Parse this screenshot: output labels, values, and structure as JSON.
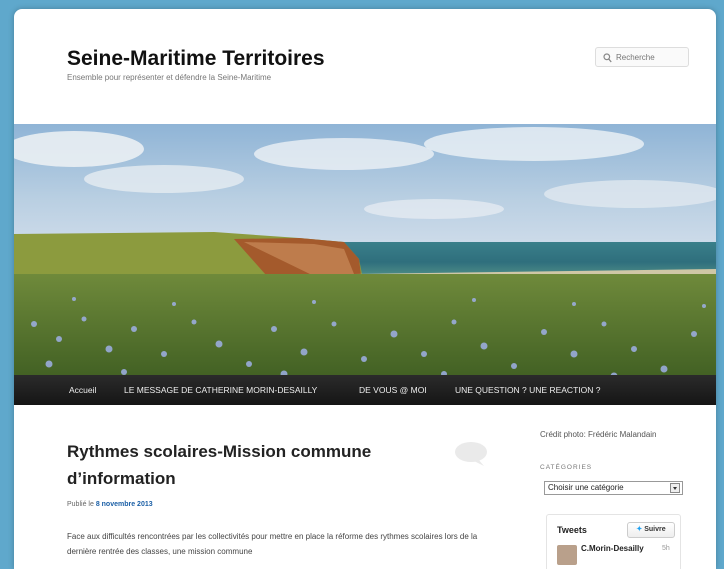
{
  "site": {
    "title": "Seine-Maritime Territoires",
    "description": "Ensemble pour représenter et défendre la Seine-Maritime"
  },
  "search": {
    "placeholder": "Recherche"
  },
  "nav": {
    "items": [
      {
        "label": "Accueil"
      },
      {
        "label": "LE MESSAGE DE CATHERINE MORIN-DESAILLY"
      },
      {
        "label": "DE VOUS @ MOI"
      },
      {
        "label": "UNE QUESTION ? UNE REACTION ?"
      }
    ]
  },
  "post": {
    "title": "Rythmes scolaires-Mission commune d’information",
    "posted_prefix": "Publié le",
    "date": "8 novembre 2013",
    "excerpt": "Face aux difficultés rencontrées par les collectivités pour mettre en place la réforme des rythmes scolaires lors de la dernière rentrée des classes, une mission commune"
  },
  "sidebar": {
    "credit": "Crédit photo: Frédéric Malandain",
    "categories_heading": "CATÉGORIES",
    "category_select": "Choisir une catégorie",
    "tweets": {
      "title": "Tweets",
      "follow_label": "Suivre",
      "author": "C.Morin-Desailly",
      "time": "5h"
    }
  },
  "colors": {
    "outer_background": "#5fa8cc",
    "nav_background": "#1f1f1f",
    "link_blue": "#1b5fa6"
  }
}
